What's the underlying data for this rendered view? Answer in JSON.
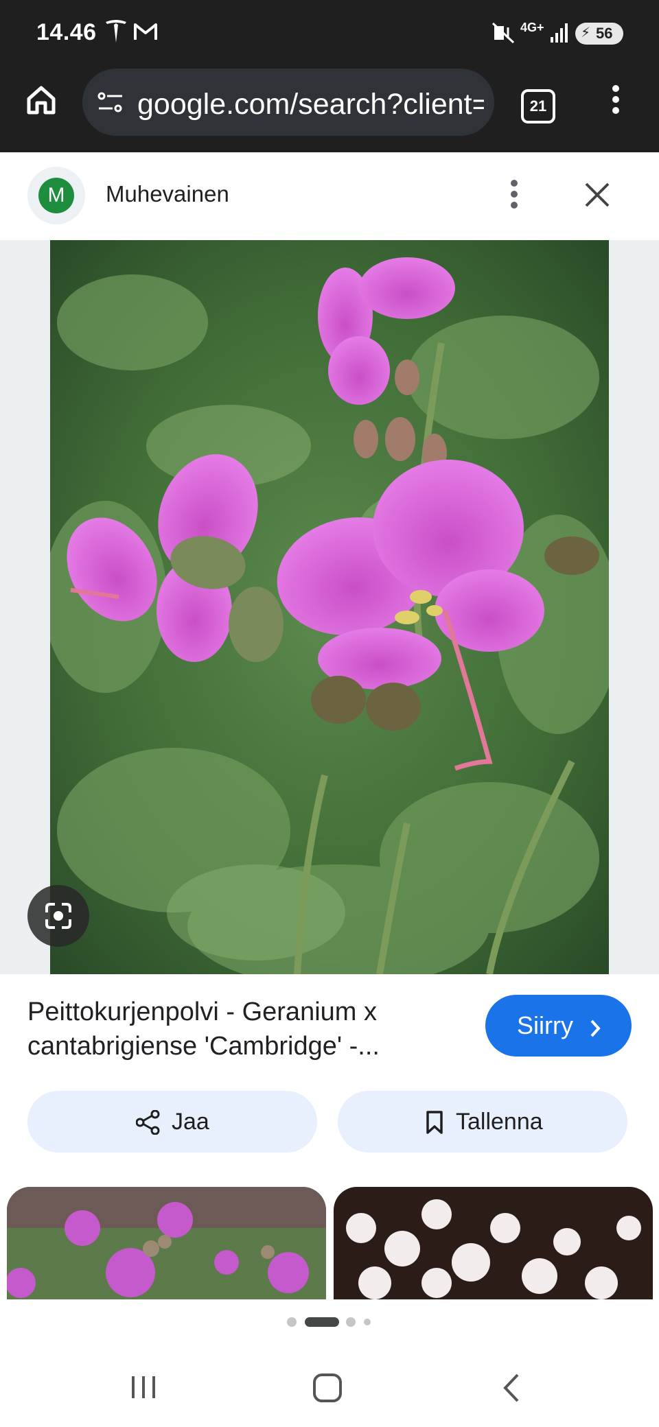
{
  "status": {
    "time": "14.46",
    "signal": "4G+",
    "battery": "56",
    "icons": [
      "tesla-icon",
      "gmail-icon",
      "mute-vibrate-icon",
      "signal-bars-icon",
      "battery-icon"
    ]
  },
  "browser": {
    "url": "google.com/search?client=r",
    "tab_count": "21",
    "icons": [
      "home-icon",
      "site-settings-icon",
      "more-vert-icon"
    ]
  },
  "source": {
    "avatar_letter": "M",
    "name": "Muhevainen",
    "icons": [
      "more-vert-icon",
      "close-icon"
    ]
  },
  "result": {
    "title_line1": "Peittokurjenpolvi - Geranium x",
    "title_line2": "cantabrigiense 'Cambridge' -...",
    "visit_label": "Siirry",
    "share_label": "Jaa",
    "save_label": "Tallenna"
  },
  "pager": {
    "dots": 4,
    "active_index": 1
  },
  "colors": {
    "accent": "#1a73e8",
    "chip_bg": "#e8f0fe",
    "topbar_bg": "#1f1f1f",
    "avatar_bg": "#1e8e3e"
  }
}
